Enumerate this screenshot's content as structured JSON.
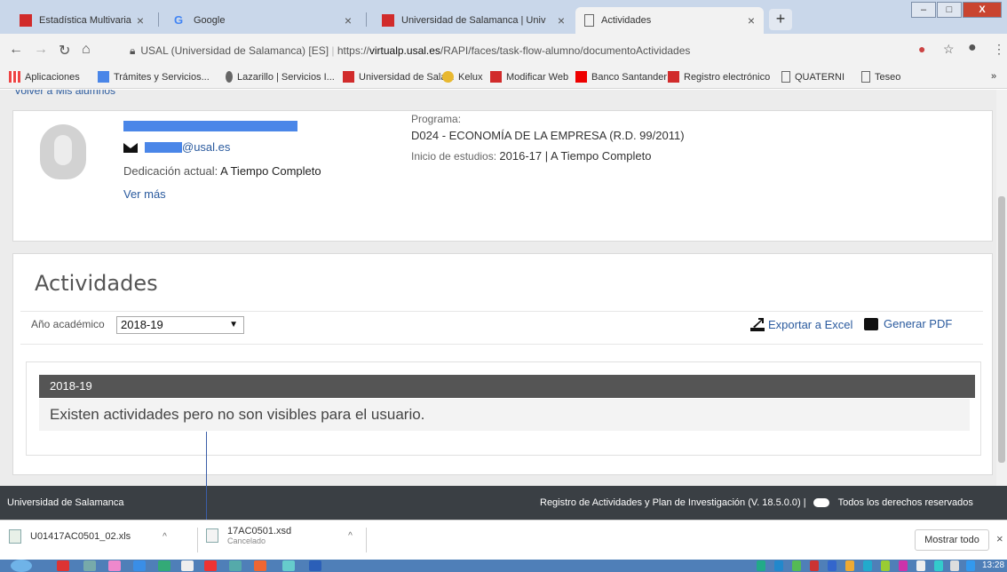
{
  "browser": {
    "tabs": [
      {
        "title": "Estadística Multivariante Aplicad",
        "icon": "usal-icon"
      },
      {
        "title": "Google",
        "icon": "google-icon"
      },
      {
        "title": "Universidad de Salamanca | Univ",
        "icon": "usal-icon"
      },
      {
        "title": "Actividades",
        "icon": "page-icon"
      }
    ],
    "new_tab_label": "+",
    "window_buttons": {
      "minimize": "–",
      "maximize": "□",
      "close": "X"
    },
    "address": {
      "site_label": "USAL (Universidad de Salamanca) [ES]",
      "url_prefix": "https://",
      "url_host": "virtualp.usal.es",
      "url_path": "/RAPI/faces/task-flow-alumno/documentoActividades"
    },
    "bookmarks": [
      "Aplicaciones",
      "Trámites y Servicios...",
      "Lazarillo | Servicios I...",
      "Universidad de Sala...",
      "Kelux",
      "Modificar Web",
      "Banco Santander",
      "Registro electrónico",
      "QUATERNI",
      "Teseo"
    ],
    "bookmarks_more": "»"
  },
  "page": {
    "back_link": "Volver a Mis alumnos",
    "profile": {
      "email_suffix": "@usal.es",
      "dedication_label": "Dedicación actual:",
      "dedication_value": "A Tiempo Completo",
      "ver_mas": "Ver más",
      "programa_label": "Programa:",
      "programa_value": "D024 - ECONOMÍA DE LA EMPRESA (R.D. 99/2011)",
      "inicio_label": "Inicio de estudios:",
      "inicio_value": "2016-17 | A Tiempo Completo"
    },
    "activities": {
      "title": "Actividades",
      "year_label": "Año académico",
      "year_value": "2018-19",
      "export_excel": "Exportar a Excel",
      "generate_pdf": "Generar PDF",
      "panel_header": "2018-19",
      "panel_message": "Existen actividades pero no son visibles para el usuario."
    }
  },
  "footer": {
    "left": "Universidad de Salamanca",
    "right_prefix": "Registro de Actividades y Plan de Investigación (V. 18.5.0.0) |",
    "right_suffix": "Todos los derechos reservados"
  },
  "downloads": [
    {
      "name": "U01417AC0501_02.xls",
      "status": ""
    },
    {
      "name": "17AC0501.xsd",
      "status": "Cancelado"
    }
  ],
  "downloads_show_all": "Mostrar todo",
  "downloads_close": "×",
  "clock": "13:28",
  "colors": {
    "link": "#2a5a9e",
    "panel_header": "#555555",
    "footer": "#3a3f44",
    "usal_red": "#d12b2b"
  }
}
